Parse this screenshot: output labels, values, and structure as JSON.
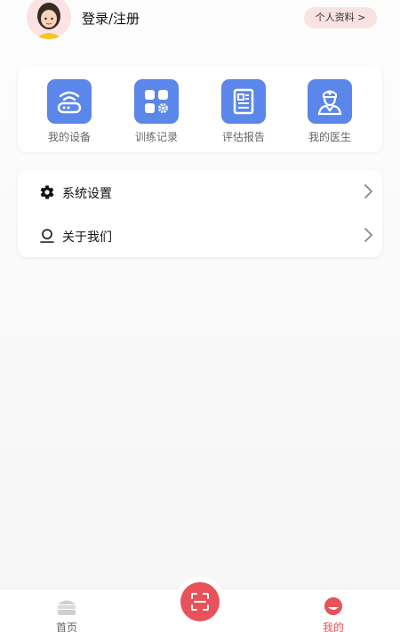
{
  "header": {
    "login_label": "登录/注册",
    "profile_button_label": "个人资料 >"
  },
  "grid": {
    "items": [
      {
        "label": "我的设备",
        "icon": "router-icon"
      },
      {
        "label": "训练记录",
        "icon": "apps-gear-icon"
      },
      {
        "label": "评估报告",
        "icon": "report-icon"
      },
      {
        "label": "我的医生",
        "icon": "doctor-icon"
      }
    ]
  },
  "menu": {
    "items": [
      {
        "label": "系统设置",
        "icon": "gear-icon"
      },
      {
        "label": "关于我们",
        "icon": "person-icon"
      }
    ]
  },
  "tabbar": {
    "home_label": "首页",
    "mine_label": "我的"
  },
  "colors": {
    "accent_blue": "#5b86ea",
    "accent_red": "#e8525a",
    "profile_pill_bg": "#f9e2e2",
    "active_tab": "#e8525a",
    "inactive_tab": "#666666"
  }
}
